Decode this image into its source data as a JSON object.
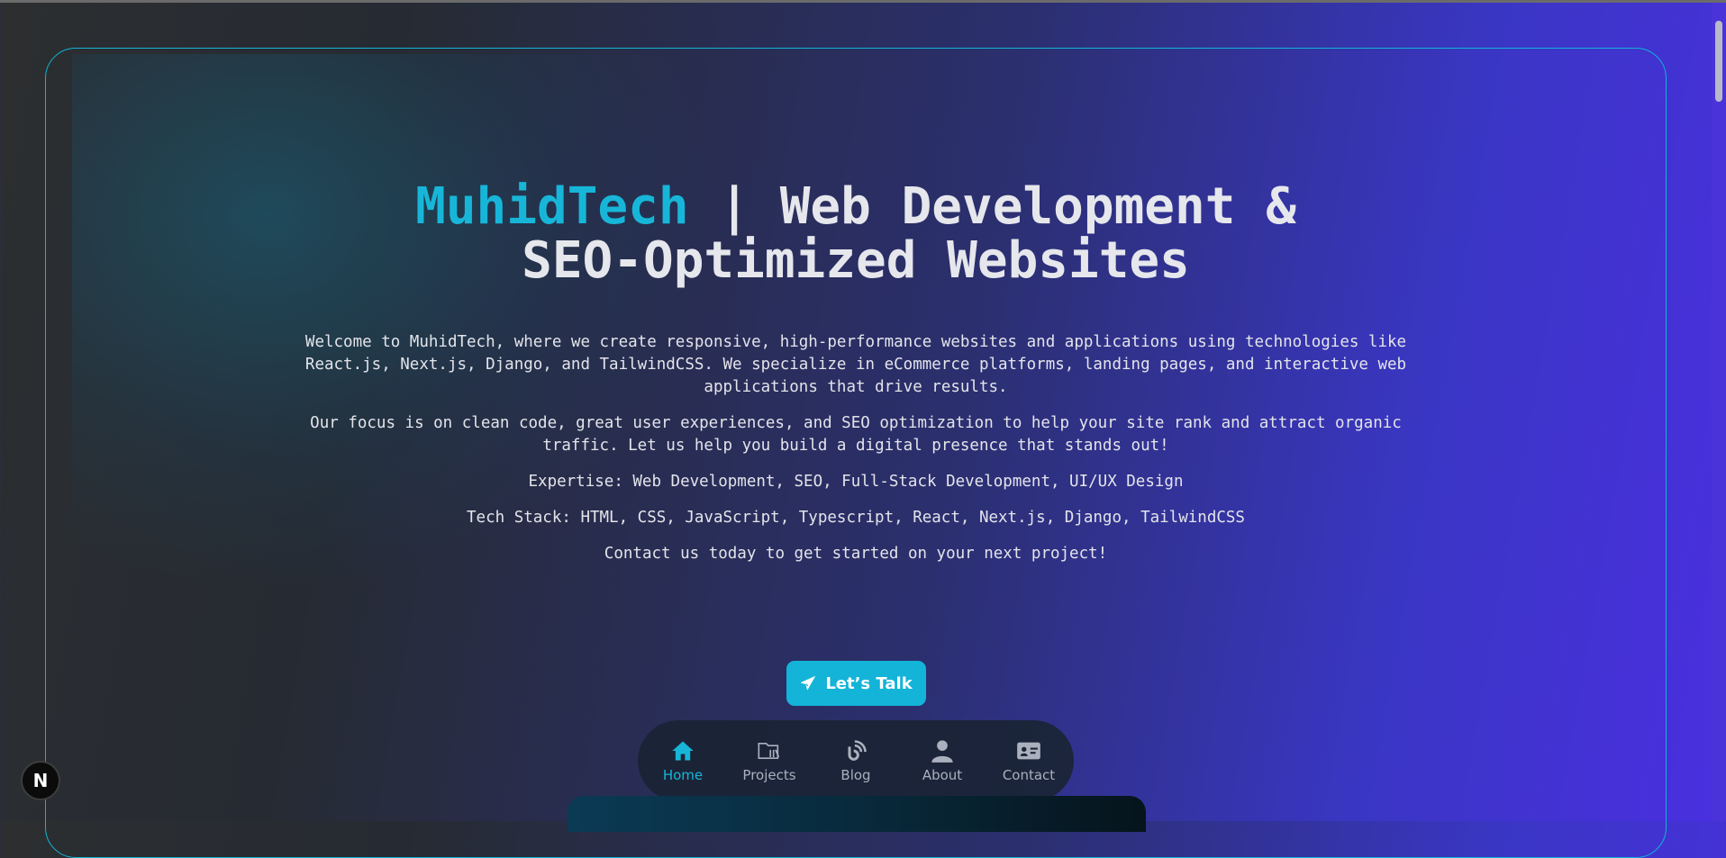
{
  "hero": {
    "brand": "MuhidTech",
    "title_rest_line1": " | Web Development &",
    "title_line2": "SEO-Optimized Websites",
    "paragraph1": "Welcome to MuhidTech, where we create responsive, high-performance websites and applications using technologies like React.js, Next.js, Django, and TailwindCSS. We specialize in eCommerce platforms, landing pages, and interactive web applications that drive results.",
    "paragraph2": "Our focus is on clean code, great user experiences, and SEO optimization to help your site rank and attract organic traffic. Let us help you build a digital presence that stands out!",
    "expertise": "Expertise: Web Development, SEO, Full-Stack Development, UI/UX Design",
    "tech_stack": "Tech Stack: HTML, CSS, JavaScript, Typescript, React, Next.js, Django, TailwindCSS",
    "contact_line": "Contact us today to get started on your next project!"
  },
  "cta": {
    "label": "Let’s Talk",
    "icon": "paper-plane-icon"
  },
  "nav": {
    "items": [
      {
        "label": "Home",
        "icon": "home-icon",
        "active": true
      },
      {
        "label": "Projects",
        "icon": "folder-icon",
        "active": false
      },
      {
        "label": "Blog",
        "icon": "blog-icon",
        "active": false
      },
      {
        "label": "About",
        "icon": "user-icon",
        "active": false
      },
      {
        "label": "Contact",
        "icon": "contact-card-icon",
        "active": false
      }
    ]
  },
  "badge": {
    "label": "N"
  },
  "colors": {
    "accent": "#17b6d8",
    "text": "#e3e4ea",
    "nav_inactive": "#aab0bd"
  }
}
